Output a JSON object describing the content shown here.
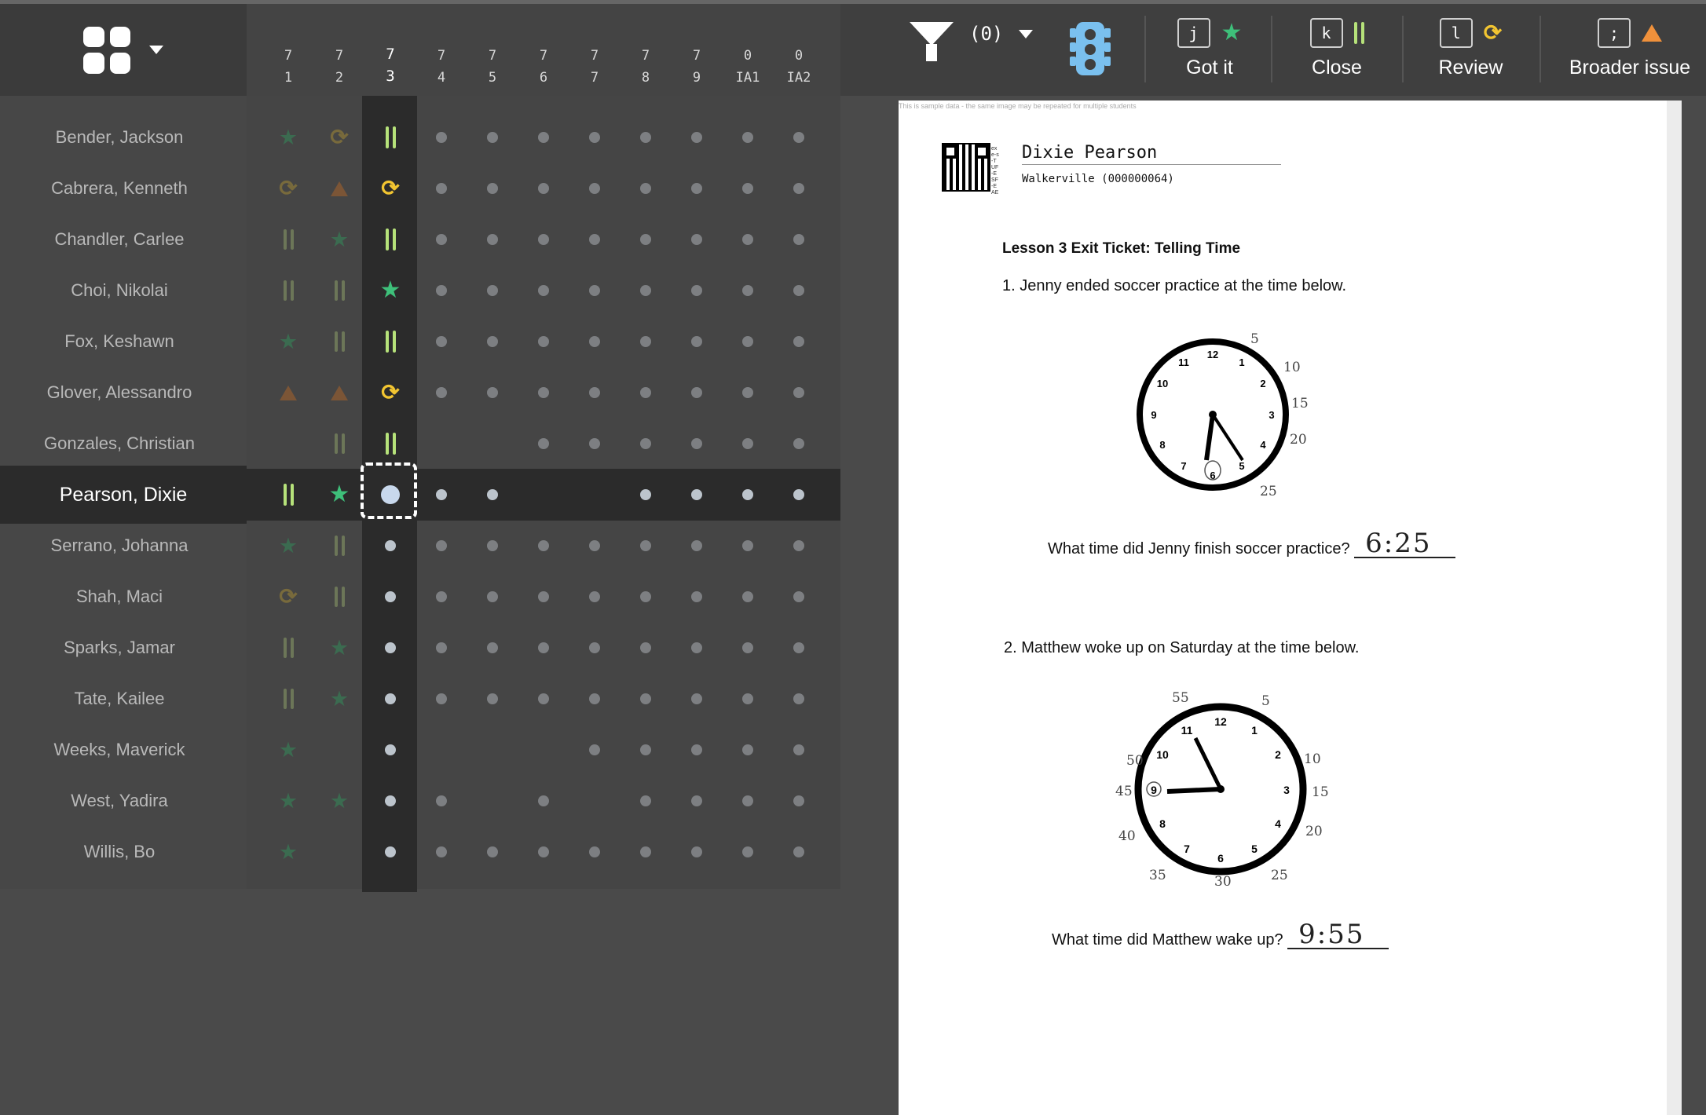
{
  "toolbar": {
    "filter_count": "(0)",
    "actions": [
      {
        "key": "j",
        "label": "Got it",
        "icon": "star-icon"
      },
      {
        "key": "k",
        "label": "Close",
        "icon": "bars-icon"
      },
      {
        "key": "l",
        "label": "Review",
        "icon": "cycle-icon"
      },
      {
        "key": ";",
        "label": "Broader issue",
        "icon": "warning-icon"
      }
    ]
  },
  "columns": [
    {
      "top": "7",
      "bottom": "1"
    },
    {
      "top": "7",
      "bottom": "2"
    },
    {
      "top": "7",
      "bottom": "3"
    },
    {
      "top": "7",
      "bottom": "4"
    },
    {
      "top": "7",
      "bottom": "5"
    },
    {
      "top": "7",
      "bottom": "6"
    },
    {
      "top": "7",
      "bottom": "7"
    },
    {
      "top": "7",
      "bottom": "8"
    },
    {
      "top": "7",
      "bottom": "9"
    },
    {
      "top": "0",
      "bottom": "IA1"
    },
    {
      "top": "0",
      "bottom": "IA2"
    }
  ],
  "active_column": 2,
  "selected_row": 7,
  "students": [
    {
      "name": "Bender, Jackson",
      "marks": [
        "S",
        "C",
        "B",
        "D",
        "D",
        "D",
        "D",
        "D",
        "D",
        "D",
        "D"
      ]
    },
    {
      "name": "Cabrera, Kenneth",
      "marks": [
        "C",
        "W",
        "C",
        "D",
        "D",
        "D",
        "D",
        "D",
        "D",
        "D",
        "D"
      ]
    },
    {
      "name": "Chandler, Carlee",
      "marks": [
        "B",
        "S",
        "B",
        "D",
        "D",
        "D",
        "D",
        "D",
        "D",
        "D",
        "D"
      ]
    },
    {
      "name": "Choi, Nikolai",
      "marks": [
        "B",
        "B",
        "S",
        "D",
        "D",
        "D",
        "D",
        "D",
        "D",
        "D",
        "D"
      ]
    },
    {
      "name": "Fox, Keshawn",
      "marks": [
        "S",
        "B",
        "B",
        "D",
        "D",
        "D",
        "D",
        "D",
        "D",
        "D",
        "D"
      ]
    },
    {
      "name": "Glover, Alessandro",
      "marks": [
        "W",
        "W",
        "C",
        "D",
        "D",
        "D",
        "D",
        "D",
        "D",
        "D",
        "D"
      ]
    },
    {
      "name": "Gonzales, Christian",
      "marks": [
        "",
        "B",
        "B",
        "",
        "",
        "D",
        "D",
        "D",
        "D",
        "D",
        "D"
      ]
    },
    {
      "name": "Pearson, Dixie",
      "marks": [
        "B",
        "S",
        "X",
        "D",
        "D",
        "",
        "",
        "D",
        "D",
        "D",
        "D"
      ]
    },
    {
      "name": "Serrano, Johanna",
      "marks": [
        "S",
        "B",
        "D",
        "D",
        "D",
        "D",
        "D",
        "D",
        "D",
        "D",
        "D"
      ]
    },
    {
      "name": "Shah, Maci",
      "marks": [
        "C",
        "B",
        "D",
        "D",
        "D",
        "D",
        "D",
        "D",
        "D",
        "D",
        "D"
      ]
    },
    {
      "name": "Sparks, Jamar",
      "marks": [
        "B",
        "S",
        "D",
        "D",
        "D",
        "D",
        "D",
        "D",
        "D",
        "D",
        "D"
      ]
    },
    {
      "name": "Tate, Kailee",
      "marks": [
        "B",
        "S",
        "D",
        "D",
        "D",
        "D",
        "D",
        "D",
        "D",
        "D",
        "D"
      ]
    },
    {
      "name": "Weeks, Maverick",
      "marks": [
        "S",
        "",
        "D",
        "",
        "",
        "",
        "D",
        "D",
        "D",
        "D",
        "D"
      ]
    },
    {
      "name": "West, Yadira",
      "marks": [
        "S",
        "S",
        "D",
        "D",
        "",
        "D",
        "",
        "D",
        "D",
        "D",
        "D"
      ]
    },
    {
      "name": "Willis, Bo",
      "marks": [
        "S",
        "",
        "D",
        "D",
        "D",
        "D",
        "D",
        "D",
        "D",
        "D",
        "D"
      ]
    }
  ],
  "document": {
    "sample_note": "This is sample data - the same image may be repeated for multiple students",
    "qr_code_text": "exe-s-TUF-ESF-EAE",
    "student_name": "Dixie Pearson",
    "school": "Walkerville (000000064)",
    "title": "Lesson 3 Exit Ticket: Telling Time",
    "q1": "1. Jenny ended soccer practice at the time below.",
    "q1_prompt": "What time did Jenny finish soccer practice?",
    "q1_answer": "6:25",
    "q2": "2. Matthew woke up on Saturday at the time below.",
    "q2_prompt": "What time did Matthew wake up?",
    "q2_answer": "9:55",
    "clock1_minute_marks": [
      "5",
      "10",
      "15",
      "20",
      "25"
    ],
    "clock2_minute_marks": [
      "55",
      "5",
      "50",
      "10",
      "45",
      "15",
      "40",
      "20",
      "35",
      "30",
      "25"
    ]
  },
  "colors": {
    "star": "#3ec07a",
    "bars": "#b6e27a",
    "cycle": "#f2c531",
    "warning": "#f0913b",
    "traffic_light": "#7ac0ef"
  }
}
